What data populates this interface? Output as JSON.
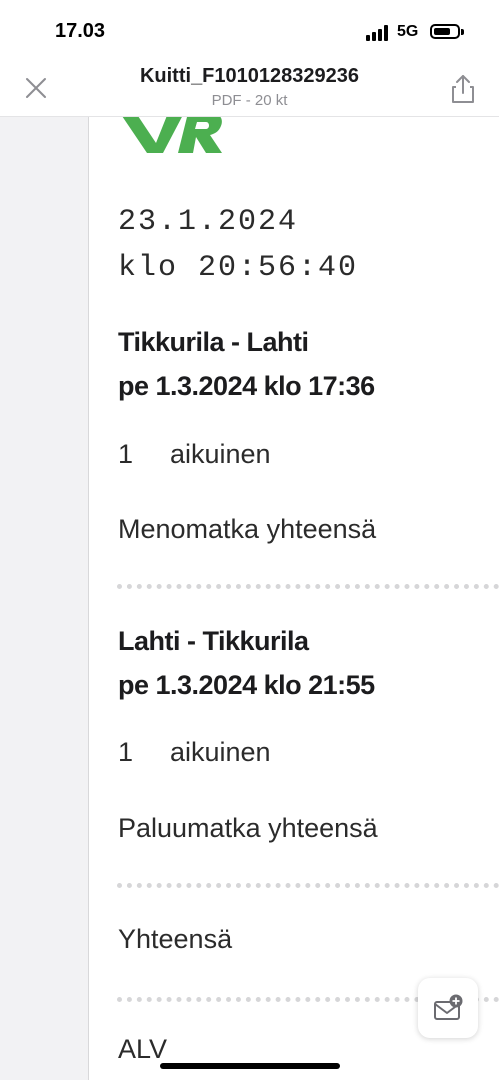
{
  "status_bar": {
    "time": "17.03",
    "network": "5G"
  },
  "header": {
    "title": "Kuitti_F1010128329236",
    "subtitle": "PDF - 20 kt"
  },
  "receipt": {
    "date": "23.1.2024",
    "time": "klo 20:56:40",
    "outbound": {
      "route": "Tikkurila - Lahti",
      "departure": "pe 1.3.2024 klo 17:36",
      "quantity": "1",
      "passenger_type": "aikuinen",
      "total_label": "Menomatka yhteensä"
    },
    "return": {
      "route": "Lahti - Tikkurila",
      "departure": "pe 1.3.2024 klo 21:55",
      "quantity": "1",
      "passenger_type": "aikuinen",
      "total_label": "Paluumatka yhteensä"
    },
    "grand_total_label": "Yhteensä",
    "vat_label": "ALV"
  },
  "colors": {
    "vr_green": "#4caf50",
    "text": "#1c1c1e",
    "subtle": "#8e8e93"
  },
  "icons": {
    "close": "close-icon",
    "share": "share-icon",
    "logo": "vr-logo",
    "fab": "mail-add-icon"
  }
}
